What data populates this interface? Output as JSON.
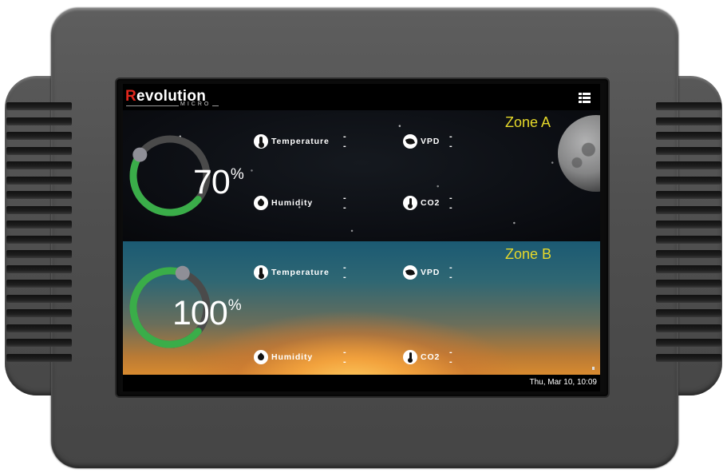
{
  "device": {
    "brand_first_letter": "R",
    "brand_rest": "evolution",
    "brand_sub": "MICRO"
  },
  "header": {
    "menu_icon": "grid-menu-icon"
  },
  "zones": [
    {
      "title": "Zone A",
      "gauge_percent": 70,
      "gauge_value": "70",
      "gauge_unit": "%",
      "background": "night-sky-with-moon",
      "sensors": {
        "temperature": {
          "label": "Temperature",
          "value": "--",
          "icon": "thermometer-icon"
        },
        "vpd": {
          "label": "VPD",
          "value": "--",
          "icon": "leaf-icon"
        },
        "humidity": {
          "label": "Humidity",
          "value": "--",
          "icon": "droplet-icon"
        },
        "co2": {
          "label": "CO2",
          "value": "--",
          "icon": "co2-sensor-icon"
        }
      }
    },
    {
      "title": "Zone B",
      "gauge_percent": 100,
      "gauge_value": "100",
      "gauge_unit": "%",
      "background": "sunrise",
      "sensors": {
        "temperature": {
          "label": "Temperature",
          "value": "--",
          "icon": "thermometer-icon"
        },
        "vpd": {
          "label": "VPD",
          "value": "--",
          "icon": "leaf-icon"
        },
        "humidity": {
          "label": "Humidity",
          "value": "--",
          "icon": "droplet-icon"
        },
        "co2": {
          "label": "CO2",
          "value": "--",
          "icon": "co2-sensor-icon"
        }
      }
    }
  ],
  "status": {
    "datetime": "Thu, Mar 10, 10:09"
  },
  "colors": {
    "gauge_track": "#4a4a4a",
    "gauge_fill": "#3aad49",
    "gauge_knob": "#8f8f97",
    "zone_title": "#e6d92a",
    "logo_accent": "#e0261c"
  }
}
